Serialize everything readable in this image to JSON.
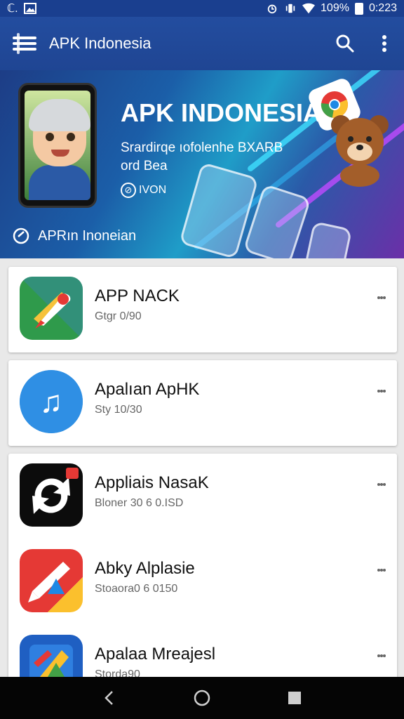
{
  "status": {
    "left_text": "ℂ.",
    "battery": "109%",
    "time": "0:223"
  },
  "appbar": {
    "title": "APK Indonesia",
    "menu_icon": "menu-icon",
    "search_icon": "search-icon",
    "overflow_icon": "more-vert-icon"
  },
  "banner": {
    "title": "APK INDONESIA",
    "subtitle": "Srardirqe ıofolenhe BXARB ord Bea",
    "badge": "IVON",
    "footer": "APRın Inoneian",
    "colors": {
      "start": "#1d3d86",
      "mid": "#1f9dc8",
      "end": "#6b2fa8"
    }
  },
  "apps": [
    {
      "name": "APP NACK",
      "meta": "Gtgr 0/90",
      "icon": "pin-icon"
    },
    {
      "name": "Apalıan ApHK",
      "meta": "Sty 10/30",
      "icon": "music-icon"
    },
    {
      "name": "Appliais NasaK",
      "meta": "Bloner 30 6 0.ISD",
      "icon": "refresh-icon"
    },
    {
      "name": "Abky Alplasie",
      "meta": "Stoaora0 6 0150",
      "icon": "edit-icon"
    },
    {
      "name": "Apalaa Mreajesl",
      "meta": "Storda90",
      "icon": "pen-icon"
    }
  ],
  "navbar": {
    "back": "back-icon",
    "home": "home-icon",
    "recents": "recents-icon"
  }
}
